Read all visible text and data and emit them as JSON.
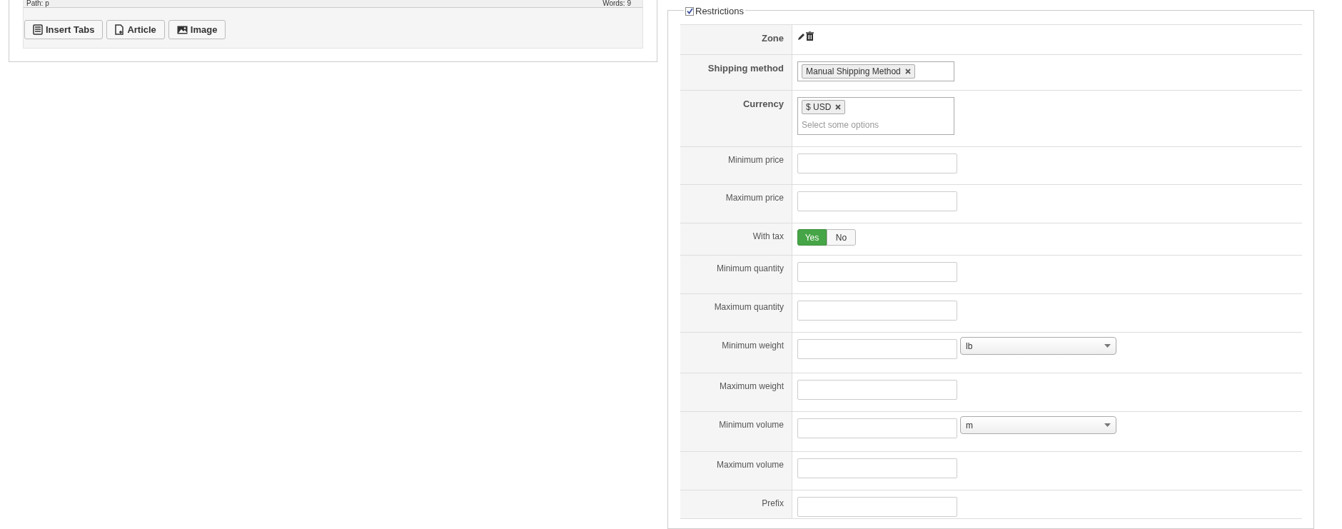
{
  "editor": {
    "path": "Path: p",
    "words": "Words: 9",
    "buttons": [
      {
        "label": "Insert Tabs",
        "kind": "tabs"
      },
      {
        "label": "Article",
        "kind": "article"
      },
      {
        "label": "Image",
        "kind": "image"
      }
    ]
  },
  "restrictions": {
    "legend": "Restrictions",
    "checked": true,
    "rows": [
      {
        "label": "Zone",
        "emphasized": true,
        "kind": "icons"
      },
      {
        "label": "Shipping method",
        "emphasized": true,
        "kind": "tags",
        "tags": [
          "Manual Shipping Method"
        ]
      },
      {
        "label": "Currency",
        "emphasized": true,
        "kind": "tags",
        "tags": [
          "$ USD"
        ],
        "placeholder": "Select some options"
      },
      {
        "label": "Minimum price",
        "emphasized": false,
        "kind": "text"
      },
      {
        "label": "Maximum price",
        "emphasized": false,
        "kind": "text"
      },
      {
        "label": "With tax",
        "emphasized": false,
        "kind": "toggle",
        "options": [
          {
            "label": "Yes",
            "selected": true
          },
          {
            "label": "No",
            "selected": false
          }
        ]
      },
      {
        "label": "Minimum quantity",
        "emphasized": false,
        "kind": "text"
      },
      {
        "label": "Maximum quantity",
        "emphasized": false,
        "kind": "text"
      },
      {
        "label": "Minimum weight",
        "emphasized": false,
        "kind": "text_unit",
        "unit": "lb"
      },
      {
        "label": "Maximum weight",
        "emphasized": false,
        "kind": "text"
      },
      {
        "label": "Minimum volume",
        "emphasized": false,
        "kind": "text_unit",
        "unit": "m"
      },
      {
        "label": "Maximum volume",
        "emphasized": false,
        "kind": "text"
      },
      {
        "label": "Prefix",
        "emphasized": false,
        "kind": "text"
      }
    ]
  }
}
